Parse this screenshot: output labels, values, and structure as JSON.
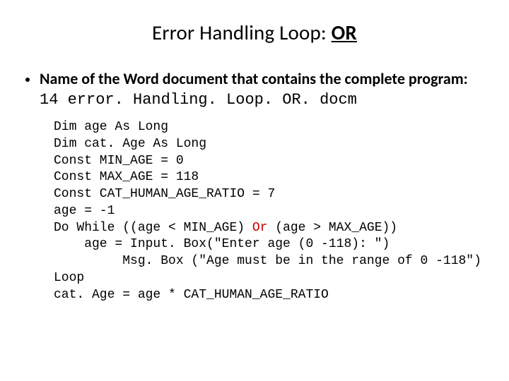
{
  "title_main": "Error Handling Loop: ",
  "title_or": "OR",
  "bullet_lead": "Name of the Word document that contains the complete program: ",
  "bullet_doc": "14 error. Handling. Loop. OR. docm",
  "code": {
    "l1": "Dim age As Long",
    "l2": "Dim cat. Age As Long",
    "l3": "Const MIN_AGE = 0",
    "l4": "Const MAX_AGE = 118",
    "l5": "Const CAT_HUMAN_AGE_RATIO = 7",
    "l6": "age = -1",
    "l7a": "Do While ((age < MIN_AGE) ",
    "l7hl": "Or",
    "l7b": " (age > MAX_AGE))",
    "l8": "    age = Input. Box(\"Enter age (0 -118): \")",
    "l9": "         Msg. Box (\"Age must be in the range of 0 -118\")",
    "l10": "Loop",
    "l11": "cat. Age = age * CAT_HUMAN_AGE_RATIO"
  }
}
